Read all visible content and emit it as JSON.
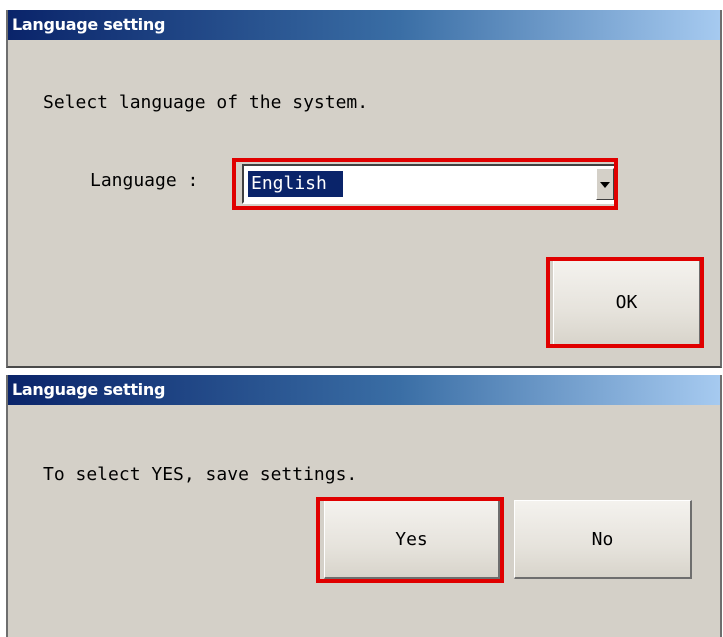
{
  "dialog1": {
    "title": "Language setting",
    "message": "Select language of the system.",
    "language_label": "Language :",
    "language_value": "English",
    "ok_label": "OK"
  },
  "dialog2": {
    "title": "Language setting",
    "message": "To select YES, save settings.",
    "yes_label": "Yes",
    "no_label": "No"
  },
  "colors": {
    "highlight": "#e00000",
    "dialog_bg": "#d4d0c8",
    "titlebar_start": "#0a246a",
    "titlebar_end": "#a6caf0",
    "selection_bg": "#0a246a"
  },
  "icons": [
    "dropdown-arrow-icon"
  ]
}
